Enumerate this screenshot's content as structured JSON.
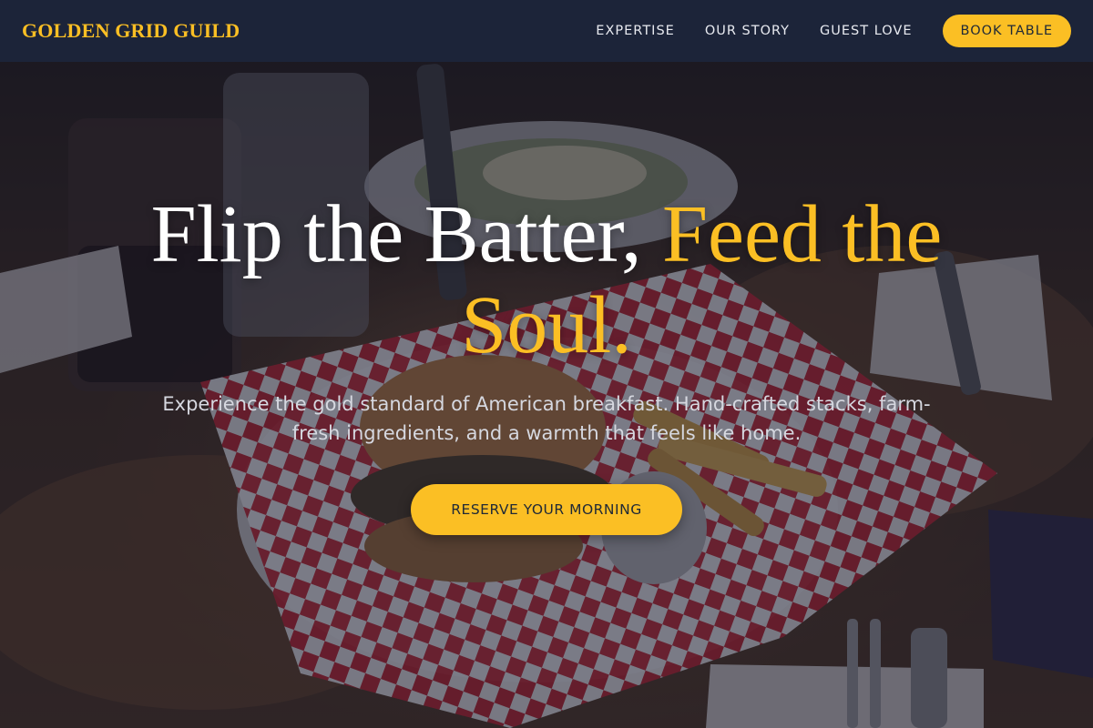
{
  "navbar": {
    "brand": "GOLDEN GRID GUILD",
    "links": [
      {
        "label": "EXPERTISE"
      },
      {
        "label": "OUR STORY"
      },
      {
        "label": "GUEST LOVE"
      }
    ],
    "book_button": "BOOK TABLE"
  },
  "hero": {
    "headline_white": "Flip the Batter, ",
    "headline_gold": "Feed the Soul.",
    "subtext": "Experience the gold standard of American breakfast. Hand-crafted stacks, farm-fresh ingredients, and a warmth that feels like home.",
    "cta": "RESERVE YOUR MORNING"
  },
  "colors": {
    "accent": "#fbbf24",
    "navbar_bg": "#1c243a",
    "text_light": "#ffffff"
  }
}
